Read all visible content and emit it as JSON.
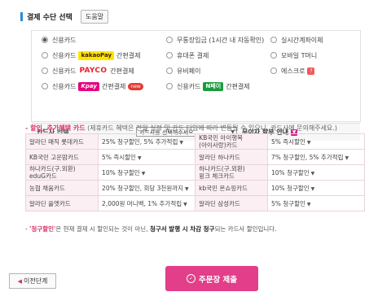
{
  "header": {
    "title": "결제 수단 선택",
    "help_label": "도움말"
  },
  "payment_options": [
    {
      "label": "신용카드",
      "selected": true
    },
    {
      "label": "무통장입금 (1시간 내 자동확인)"
    },
    {
      "label": "실시간계좌이체"
    },
    {
      "pre": "신용카드",
      "logo": "kakaoPay",
      "post": "간편결제"
    },
    {
      "label": "휴대폰 결제"
    },
    {
      "label": "모바일 T머니"
    },
    {
      "pre": "신용카드",
      "logo": "PAYCO",
      "post": "간편결제"
    },
    {
      "label": "유비페이"
    },
    {
      "label": "에스크로",
      "badge": "?"
    },
    {
      "pre": "신용카드",
      "logo": "Kpay",
      "post": "간편결제",
      "badge": "new"
    },
    {
      "pre": "신용카드",
      "logo": "N페이",
      "post": "간편결제"
    }
  ],
  "card_row": {
    "label": "카드사 선택",
    "select_value": "카드사를 선택해주세요.",
    "installment_label": "무이자 할부 안내"
  },
  "discount": {
    "title": "할인, 추가혜택 카드",
    "subtitle": "(제휴카드 혜택은 전월 실적 및 카드 타입에 따라 변동될 수 있으니, 카드사에 문의해주세요.)",
    "rows": [
      {
        "c1": "알라딘 매직 롯데카드",
        "v1": "25% 청구할인, 5% 추가적립",
        "c2": "KB국민 아이행복\n(아이사랑)카드",
        "v2": "5% 즉시할인"
      },
      {
        "c1": "KB국민 고운맘카드",
        "v1": "5% 즉시할인",
        "c2": "알라딘 하나카드",
        "v2": "7% 청구할인, 5% 추가적립"
      },
      {
        "c1": "하나카드(구.외환)\neduG카드",
        "v1": "10% 청구할인",
        "c2": "하나카드(구.외환)\n윙크 체크카드",
        "v2": "10% 청구할인"
      },
      {
        "c1": "농협 채움카드",
        "v1": "20% 청구할인, 회당 3천원까지",
        "c2": "kb국민 온쇼핑카드",
        "v2": "10% 청구할인"
      },
      {
        "c1": "알라딘 올엣카드",
        "v1": "2,000원 머니백, 1% 추가적립",
        "c2": "알라딘 삼성카드",
        "v2": "5% 청구할인"
      }
    ]
  },
  "note": {
    "dash": "- ",
    "q1": "'청구할인'",
    "t1": "은 현재 결제 시 할인되는 것이 아닌,",
    "t2": "청구서 발행 시 차감 청구",
    "t3": "되는 카드사 할인입니다."
  },
  "buttons": {
    "prev": "이전단계",
    "submit": "주문장 제출"
  }
}
